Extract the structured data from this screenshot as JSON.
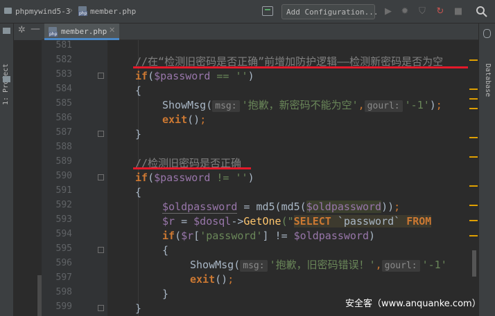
{
  "breadcrumb": {
    "project": "phpmywind5-3",
    "file": "member.php"
  },
  "toolbar": {
    "add_configuration": "Add Configuration..."
  },
  "tabs": [
    {
      "label": "member.php"
    }
  ],
  "side_panels": {
    "left": "1: Project",
    "right": "Database"
  },
  "gutter": {
    "line_numbers": [
      "581",
      "582",
      "583",
      "584",
      "585",
      "586",
      "587",
      "588",
      "589",
      "590",
      "591",
      "592",
      "593",
      "594",
      "595",
      "596",
      "597",
      "598",
      "599"
    ]
  },
  "code": {
    "l582_comment": "//在“检测旧密码是否正确”前增加防护逻辑——检测新密码是否为空",
    "l583_if": "if",
    "l583_var": "$password",
    "l583_rest": " == ''",
    "l584": "{",
    "l585_fn": "ShowMsg",
    "l585_hint1": "msg:",
    "l585_str1": "'抱歉，新密码不能为空'",
    "l585_hint2": "gourl:",
    "l585_str2": "'-1'",
    "l586_exit": "exit",
    "l587": "}",
    "l589_comment": "//检测旧密码是否正确",
    "l590_if": "if",
    "l590_var": "$password",
    "l590_rest": " != ''",
    "l591": "{",
    "l592_var1": "$oldpassword",
    "l592_mid": " = md5(md5(",
    "l592_var2": "$oldpassword",
    "l593_var1": "$r",
    "l593_eq": " = ",
    "l593_var2": "$dosql",
    "l593_arrow": "->",
    "l593_fn": "GetOne",
    "l593_q": "(\"",
    "l593_sql1": "SELECT",
    "l593_sql2": " `password` ",
    "l593_sql3": "FROM",
    "l594_if": "if",
    "l594_var": "$r",
    "l594_key": "'password'",
    "l594_op": "] != ",
    "l594_var2": "$oldpassword",
    "l595": "{",
    "l596_fn": "ShowMsg",
    "l596_hint1": "msg:",
    "l596_str1": "'抱歉，旧密码错误！'",
    "l596_hint2": "gourl:",
    "l596_str2": "'-1'",
    "l597_exit": "exit",
    "l598": "}",
    "l599": "}"
  },
  "watermark": "安全客（www.anquanke.com）",
  "colors": {
    "background": "#2b2b2b",
    "keyword": "#cc7832",
    "variable": "#9876aa",
    "string": "#6a8759",
    "comment": "#808080",
    "function": "#ffc66d",
    "annotation_red": "#e5192a",
    "warning_mark": "#e0a000"
  },
  "icons": [
    "folder-icon",
    "php-file-icon",
    "build-icon",
    "run-icon",
    "debug-icon",
    "coverage-icon",
    "profile-icon",
    "stop-icon",
    "search-icon",
    "collapse-icon",
    "settings-icon",
    "close-icon"
  ]
}
